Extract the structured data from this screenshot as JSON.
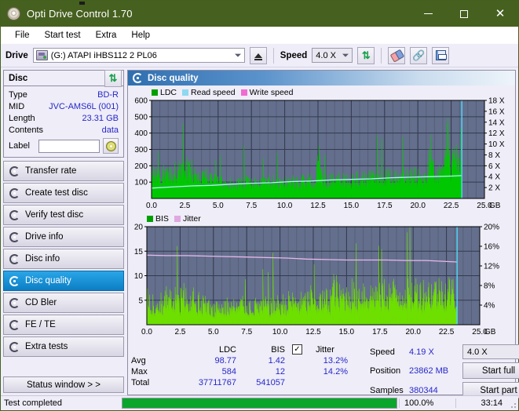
{
  "window": {
    "title": "Opti Drive Control 1.70",
    "title_icon": "disc-icon",
    "minimize": "—",
    "maximize": "□",
    "close": "✕",
    "titlebar_color": "#46601f"
  },
  "menu": {
    "items": [
      "File",
      "Start test",
      "Extra",
      "Help"
    ]
  },
  "toolbar": {
    "drive_label": "Drive",
    "drive_value": "(G:)   ATAPI iHBS112  2 PL06",
    "eject_icon": "eject-icon",
    "speed_label": "Speed",
    "speed_value": "4.0 X",
    "refresh_icon": "refresh-icon",
    "eraser_icon": "eraser-icon",
    "chain_icon": "chain-icon",
    "save_icon": "save-icon"
  },
  "disc": {
    "header": "Disc",
    "refresh_icon": "refresh-icon",
    "rows": [
      {
        "key": "Type",
        "value": "BD-R"
      },
      {
        "key": "MID",
        "value": "JVC-AMS6L (001)"
      },
      {
        "key": "Length",
        "value": "23.31 GB"
      },
      {
        "key": "Contents",
        "value": "data"
      }
    ],
    "label_key": "Label",
    "label_value": "",
    "label_placeholder": "",
    "disc_button_icon": "cd-icon"
  },
  "sidebar": {
    "items": [
      {
        "label": "Transfer rate",
        "active": false
      },
      {
        "label": "Create test disc",
        "active": false
      },
      {
        "label": "Verify test disc",
        "active": false
      },
      {
        "label": "Drive info",
        "active": false
      },
      {
        "label": "Disc info",
        "active": false
      },
      {
        "label": "Disc quality",
        "active": true
      },
      {
        "label": "CD Bler",
        "active": false
      },
      {
        "label": "FE / TE",
        "active": false
      },
      {
        "label": "Extra tests",
        "active": false
      }
    ],
    "status_window": "Status window > >"
  },
  "main": {
    "panel_title": "Disc quality",
    "panel_icon": "disc-quality-icon"
  },
  "chart_data": [
    {
      "type": "area",
      "title": "LDC / Read speed",
      "xlabel": "GB",
      "ylabel": "",
      "xlim": [
        0.0,
        25.0
      ],
      "xticks": [
        "0.0",
        "2.5",
        "5.0",
        "7.5",
        "10.0",
        "12.5",
        "15.0",
        "17.5",
        "20.0",
        "22.5",
        "25.0"
      ],
      "x_unit": "GB",
      "ylim": [
        0,
        600
      ],
      "yticks": [
        "100",
        "200",
        "300",
        "400",
        "500",
        "600"
      ],
      "y2lim": [
        0,
        18
      ],
      "y2ticks": [
        "2 X",
        "4 X",
        "6 X",
        "8 X",
        "10 X",
        "12 X",
        "14 X",
        "16 X",
        "18 X"
      ],
      "grid": true,
      "plot_bg": "#646f8e",
      "legend": [
        {
          "name": "LDC",
          "color": "#00a000"
        },
        {
          "name": "Read speed",
          "color": "#8ed8f0"
        },
        {
          "name": "Write speed",
          "color": "#f06cd0"
        }
      ],
      "series": [
        {
          "name": "LDC",
          "color": "#00c800",
          "kind": "area",
          "x": [
            0.0,
            0.3,
            0.6,
            0.9,
            1.2,
            1.5,
            1.8,
            2.1,
            2.4,
            2.7,
            3.0,
            3.3,
            3.6,
            3.9,
            4.2,
            4.5,
            4.8,
            5.1,
            5.4,
            5.7,
            6.0,
            6.3,
            6.6,
            6.9,
            7.2,
            7.5,
            7.8,
            8.1,
            8.4,
            8.7,
            9.0,
            9.3,
            9.6,
            9.9,
            10.2,
            10.5,
            10.8,
            11.1,
            11.4,
            11.7,
            12.0,
            12.3,
            12.6,
            12.9,
            13.2,
            13.5,
            13.8,
            14.1,
            14.4,
            14.7,
            15.0,
            15.3,
            15.6,
            15.9,
            16.2,
            16.5,
            16.8,
            17.1,
            17.4,
            17.7,
            18.0,
            18.3,
            18.6,
            18.9,
            19.2,
            19.5,
            19.8,
            20.1,
            20.4,
            20.7,
            21.0,
            21.3,
            21.6,
            21.9,
            22.2,
            22.5,
            22.8,
            23.1,
            23.3
          ],
          "values": [
            320,
            175,
            180,
            195,
            215,
            225,
            235,
            230,
            240,
            245,
            230,
            215,
            205,
            195,
            180,
            165,
            150,
            140,
            135,
            130,
            130,
            128,
            130,
            132,
            135,
            133,
            130,
            132,
            135,
            138,
            140,
            142,
            140,
            138,
            142,
            145,
            143,
            140,
            145,
            150,
            148,
            145,
            380,
            150,
            148,
            150,
            155,
            160,
            158,
            155,
            160,
            165,
            163,
            160,
            168,
            172,
            170,
            168,
            175,
            180,
            178,
            175,
            182,
            186,
            184,
            182,
            190,
            196,
            192,
            190,
            420,
            200,
            205,
            210,
            560,
            215,
            480,
            230,
            300
          ]
        },
        {
          "name": "Read speed",
          "color": "#b0f0ff",
          "kind": "line",
          "axis": "y2",
          "x": [
            0.0,
            1.5,
            3.0,
            4.5,
            6.0,
            7.5,
            9.0,
            10.5,
            12.0,
            13.5,
            15.0,
            16.5,
            18.0,
            19.5,
            21.0,
            22.5,
            23.3
          ],
          "values": [
            1.9,
            2.1,
            2.3,
            2.4,
            2.6,
            2.8,
            2.9,
            3.1,
            3.2,
            3.4,
            3.5,
            3.6,
            3.8,
            3.9,
            4.0,
            4.1,
            4.19
          ]
        }
      ]
    },
    {
      "type": "area",
      "title": "BIS / Jitter",
      "xlabel": "GB",
      "xlim": [
        0.0,
        25.0
      ],
      "xticks": [
        "0.0",
        "2.5",
        "5.0",
        "7.5",
        "10.0",
        "12.5",
        "15.0",
        "17.5",
        "20.0",
        "22.5",
        "25.0"
      ],
      "x_unit": "GB",
      "ylim": [
        0,
        20
      ],
      "yticks": [
        "5",
        "10",
        "15",
        "20"
      ],
      "y2lim": [
        0,
        20
      ],
      "y2ticks": [
        "4%",
        "8%",
        "12%",
        "16%",
        "20%"
      ],
      "grid": true,
      "plot_bg": "#646f8e",
      "legend": [
        {
          "name": "BIS",
          "color": "#00a000"
        },
        {
          "name": "Jitter",
          "color": "#e0a8e0"
        }
      ],
      "series": [
        {
          "name": "BIS",
          "color": "#6ee000",
          "kind": "area",
          "x": [
            0.0,
            0.3,
            0.6,
            0.9,
            1.2,
            1.5,
            1.8,
            2.1,
            2.4,
            2.7,
            3.0,
            3.3,
            3.6,
            3.9,
            4.2,
            4.5,
            4.8,
            5.1,
            5.4,
            5.7,
            6.0,
            6.3,
            6.6,
            6.9,
            7.2,
            7.5,
            7.8,
            8.1,
            8.4,
            8.7,
            9.0,
            9.3,
            9.6,
            9.9,
            10.2,
            10.5,
            10.8,
            11.1,
            11.4,
            11.7,
            12.0,
            12.3,
            12.6,
            12.9,
            13.2,
            13.5,
            13.8,
            14.1,
            14.4,
            14.7,
            15.0,
            15.3,
            15.6,
            15.9,
            16.2,
            16.5,
            16.8,
            17.1,
            17.4,
            17.7,
            18.0,
            18.3,
            18.6,
            18.9,
            19.2,
            19.5,
            19.8,
            20.1,
            20.4,
            20.7,
            21.0,
            21.3,
            21.6,
            21.9,
            22.2,
            22.5,
            22.8,
            23.1,
            23.3
          ],
          "values": [
            8.0,
            6.6,
            6.8,
            7.0,
            6.6,
            8.5,
            7.2,
            8.6,
            7.0,
            9.6,
            7.4,
            7.0,
            9.4,
            6.8,
            7.2,
            5.6,
            5.2,
            5.4,
            5.6,
            5.2,
            5.8,
            5.4,
            5.6,
            5.2,
            6.8,
            5.4,
            5.8,
            5.6,
            6.0,
            5.8,
            6.2,
            6.0,
            6.4,
            6.2,
            6.6,
            6.4,
            7.8,
            6.6,
            7.0,
            6.8,
            7.2,
            8.6,
            6.8,
            7.4,
            7.2,
            7.8,
            8.6,
            12.0,
            8.4,
            9.0,
            8.8,
            10.4,
            9.0,
            9.2,
            10.6,
            9.4,
            9.0,
            9.8,
            9.2,
            10.2,
            9.4,
            9.6,
            10.0,
            9.2,
            9.8,
            10.4,
            9.6,
            10.0,
            11.0,
            9.8,
            10.2,
            9.8,
            10.6,
            10.2,
            11.0,
            10.4,
            10.6,
            9.8,
            7.0
          ]
        },
        {
          "name": "Jitter",
          "color": "#e9b8e9",
          "kind": "line",
          "axis": "y2",
          "x": [
            0.0,
            1.5,
            3.0,
            4.5,
            6.0,
            7.5,
            9.0,
            10.5,
            12.0,
            13.5,
            15.0,
            16.5,
            18.0,
            19.5,
            21.0,
            22.5,
            23.3
          ],
          "values": [
            14.2,
            14.1,
            14.1,
            14.0,
            13.9,
            13.8,
            13.7,
            13.6,
            13.4,
            13.3,
            13.2,
            13.2,
            13.2,
            13.1,
            13.1,
            12.9,
            12.8
          ]
        }
      ]
    }
  ],
  "stats": {
    "columns": [
      "LDC",
      "BIS"
    ],
    "jitter_label": "Jitter",
    "jitter_checked": true,
    "rows": [
      {
        "label": "Avg",
        "ldc": "98.77",
        "bis": "1.42",
        "jitter": "13.2%"
      },
      {
        "label": "Max",
        "ldc": "584",
        "bis": "12",
        "jitter": "14.2%"
      },
      {
        "label": "Total",
        "ldc": "37711767",
        "bis": "541057",
        "jitter": ""
      }
    ]
  },
  "test_controls": {
    "speed_label": "Speed",
    "speed_value": "4.19 X",
    "position_label": "Position",
    "position_value": "23862 MB",
    "samples_label": "Samples",
    "samples_value": "380344",
    "speed_select": "4.0 X",
    "start_full": "Start full",
    "start_part": "Start part"
  },
  "statusbar": {
    "message": "Test completed",
    "percent": "100.0%",
    "progress": 100,
    "elapsed": "33:14",
    "progress_color": "#0aa52b"
  }
}
